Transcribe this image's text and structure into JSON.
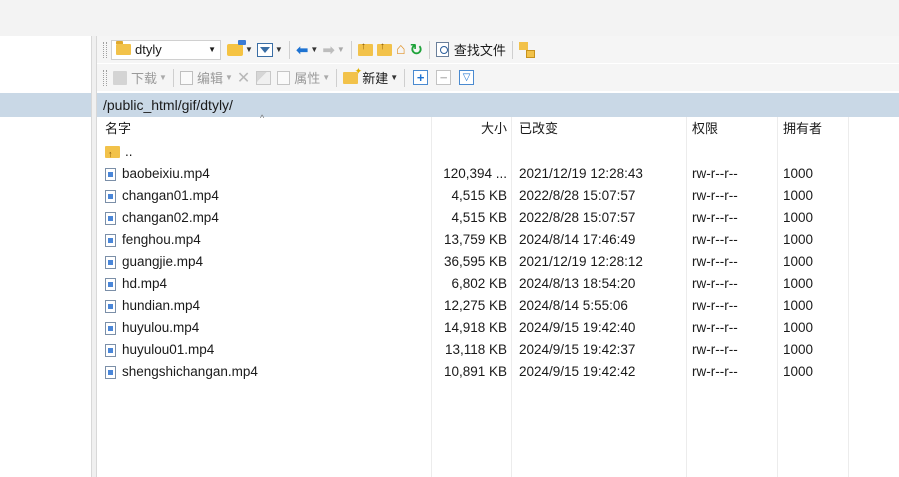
{
  "toolbar_top": {
    "dir_combo_value": "dtyly",
    "find_files_label": "查找文件"
  },
  "toolbar_bottom": {
    "download_label": "下载",
    "edit_label": "编辑",
    "properties_label": "属性",
    "new_label": "新建"
  },
  "path": "/public_html/gif/dtyly/",
  "columns": {
    "name": "名字",
    "size": "大小",
    "modified": "已改变",
    "permissions": "权限",
    "owner": "拥有者"
  },
  "parent_dir_label": "..",
  "files": [
    {
      "name": "baobeixiu.mp4",
      "size": "120,394 ...",
      "modified": "2021/12/19 12:28:43",
      "permissions": "rw-r--r--",
      "owner": "1000"
    },
    {
      "name": "changan01.mp4",
      "size": "4,515 KB",
      "modified": "2022/8/28 15:07:57",
      "permissions": "rw-r--r--",
      "owner": "1000"
    },
    {
      "name": "changan02.mp4",
      "size": "4,515 KB",
      "modified": "2022/8/28 15:07:57",
      "permissions": "rw-r--r--",
      "owner": "1000"
    },
    {
      "name": "fenghou.mp4",
      "size": "13,759 KB",
      "modified": "2024/8/14 17:46:49",
      "permissions": "rw-r--r--",
      "owner": "1000"
    },
    {
      "name": "guangjie.mp4",
      "size": "36,595 KB",
      "modified": "2021/12/19 12:28:12",
      "permissions": "rw-r--r--",
      "owner": "1000"
    },
    {
      "name": "hd.mp4",
      "size": "6,802 KB",
      "modified": "2024/8/13 18:54:20",
      "permissions": "rw-r--r--",
      "owner": "1000"
    },
    {
      "name": "hundian.mp4",
      "size": "12,275 KB",
      "modified": "2024/8/14 5:55:06",
      "permissions": "rw-r--r--",
      "owner": "1000"
    },
    {
      "name": "huyulou.mp4",
      "size": "14,918 KB",
      "modified": "2024/9/15 19:42:40",
      "permissions": "rw-r--r--",
      "owner": "1000"
    },
    {
      "name": "huyulou01.mp4",
      "size": "13,118 KB",
      "modified": "2024/9/15 19:42:37",
      "permissions": "rw-r--r--",
      "owner": "1000"
    },
    {
      "name": "shengshichangan.mp4",
      "size": "10,891 KB",
      "modified": "2024/9/15 19:42:42",
      "permissions": "rw-r--r--",
      "owner": "1000"
    }
  ],
  "icons": {
    "folder": "folder-icon",
    "file": "video-file-icon",
    "parent": "parent-folder-icon"
  },
  "colors": {
    "path_bar_bg": "#c9d8e6",
    "accent_blue": "#1e73d2",
    "folder_yellow": "#f2c24a"
  }
}
